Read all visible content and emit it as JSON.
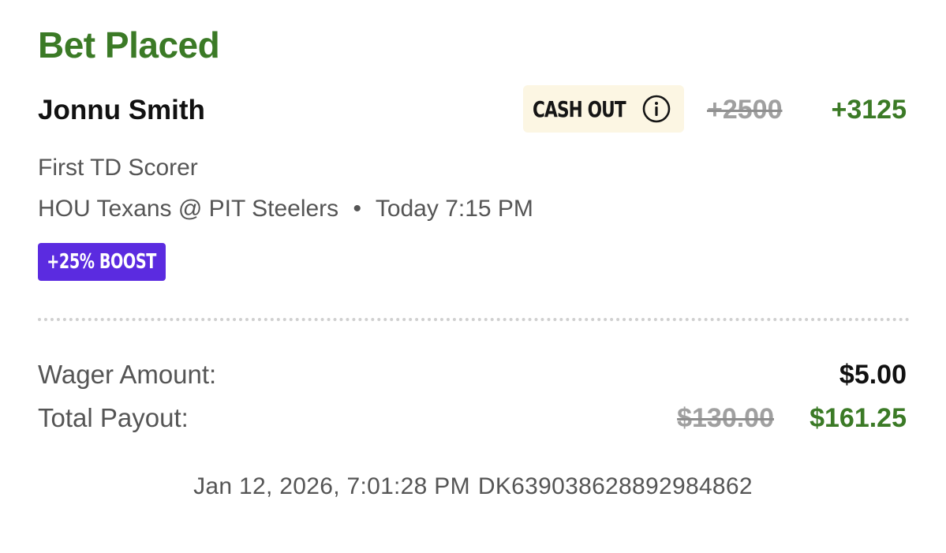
{
  "header": {
    "title": "Bet Placed"
  },
  "selection": {
    "player": "Jonnu Smith",
    "cashout_label": "CASH OUT",
    "cashout_icon": "info-icon",
    "odds_original": "+2500",
    "odds_boosted": "+3125",
    "market": "First TD Scorer",
    "event_matchup": "HOU Texans @ PIT Steelers",
    "event_separator": "•",
    "event_time": "Today 7:15 PM",
    "boost_badge": "+25% BOOST"
  },
  "summary": {
    "wager_label": "Wager Amount:",
    "wager_value": "$5.00",
    "payout_label": "Total Payout:",
    "payout_original": "$130.00",
    "payout_boosted": "$161.25"
  },
  "footer": {
    "timestamp": "Jan 12, 2026, 7:01:28 PM",
    "bet_id": "DK639038628892984862"
  },
  "colors": {
    "accent_green": "#3b7a26",
    "boost_purple": "#5b2be0",
    "cashout_bg": "#fcf6e3",
    "strikethrough_gray": "#a0a0a0",
    "secondary_text": "#555555"
  }
}
